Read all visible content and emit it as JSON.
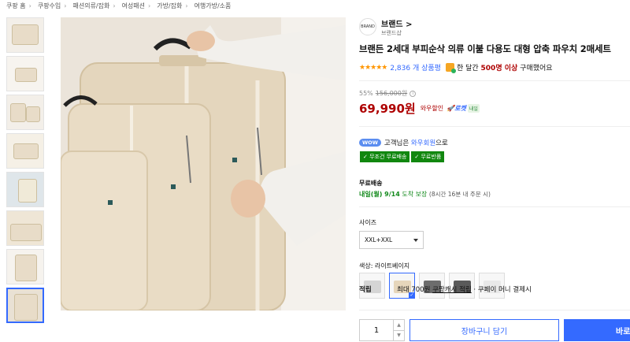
{
  "breadcrumb": [
    "쿠팡 홈",
    "쿠팡수입",
    "패션의류/잡화",
    "여성패션",
    "가방/잡화",
    "여행가방/소품"
  ],
  "brand": {
    "logo_text": "BRAND",
    "name": "브랜드 >",
    "sub": "브랜드샵"
  },
  "product": {
    "title": "브랜든 2세대 부피순삭 의류 이불 다용도 대형 압축 파우치 2매세트",
    "stars": "★★★★★",
    "reviews": "2,836 개 상품평",
    "buy_prefix": "한 달간",
    "buy_count": "500명 이상",
    "buy_suffix": "구매했어요"
  },
  "price": {
    "discount": "55%",
    "original": "156,000원",
    "current": "69,990원",
    "wow_label": "와우할인",
    "rocket": "🚀로켓",
    "rocket_badge": "내일"
  },
  "wow": {
    "badge": "WOW",
    "prefix": "고객님은",
    "link": "와우회원",
    "suffix": "으로",
    "tags": [
      "✓ 무조건 무료배송",
      "✓ 무료반품"
    ]
  },
  "shipping": {
    "label": "무료배송",
    "eta": "내일(월) 9/14",
    "guarantee": "도착 보장",
    "note": "(8시간 16분 내 주문 시)"
  },
  "size": {
    "label": "사이즈",
    "selected": "XXL+XXL"
  },
  "color": {
    "label": "색상: 라이트베이지",
    "swatches": [
      "#d5d5d5",
      "#e6d6bb",
      "#6d6d6d",
      "#5a5a5a",
      "#e9e9e9"
    ]
  },
  "benefit": {
    "label": "적립",
    "prefix": "최대 700원",
    "link": "쿠팡캐시 적립",
    "suffix": "· 쿠페이 머니 결제시"
  },
  "purchase": {
    "qty": "1",
    "cart": "장바구니 담기",
    "buy": "바로구매"
  },
  "colors": {
    "accent": "#346aff",
    "price": "#ae0000",
    "green": "#11870f"
  }
}
